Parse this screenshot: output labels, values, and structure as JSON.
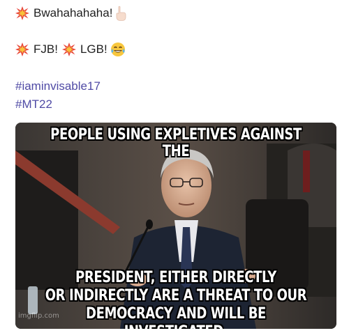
{
  "post": {
    "line1": {
      "text": "Bwahahahaha!"
    },
    "line2": {
      "part1": "FJB!",
      "part2": "LGB!"
    },
    "hashtags": [
      "#iaminvisable17",
      "#MT22"
    ]
  },
  "meme": {
    "caption_top": "PEOPLE USING EXPLETIVES AGAINST THE",
    "caption_bottom_1": "PRESIDENT, EITHER DIRECTLY",
    "caption_bottom_2": "OR INDIRECTLY ARE A THREAT TO OUR",
    "caption_bottom_3": "DEMOCRACY AND WILL BE INVESTIGATED.",
    "watermark": "imgflip.com"
  },
  "icons": {
    "burst": "collision-burst-icon",
    "hand": "pointing-down-hand-icon",
    "laugh": "tears-of-joy-icon"
  },
  "colors": {
    "hashtag": "#4f4aa5",
    "burst": "#e8443a"
  }
}
